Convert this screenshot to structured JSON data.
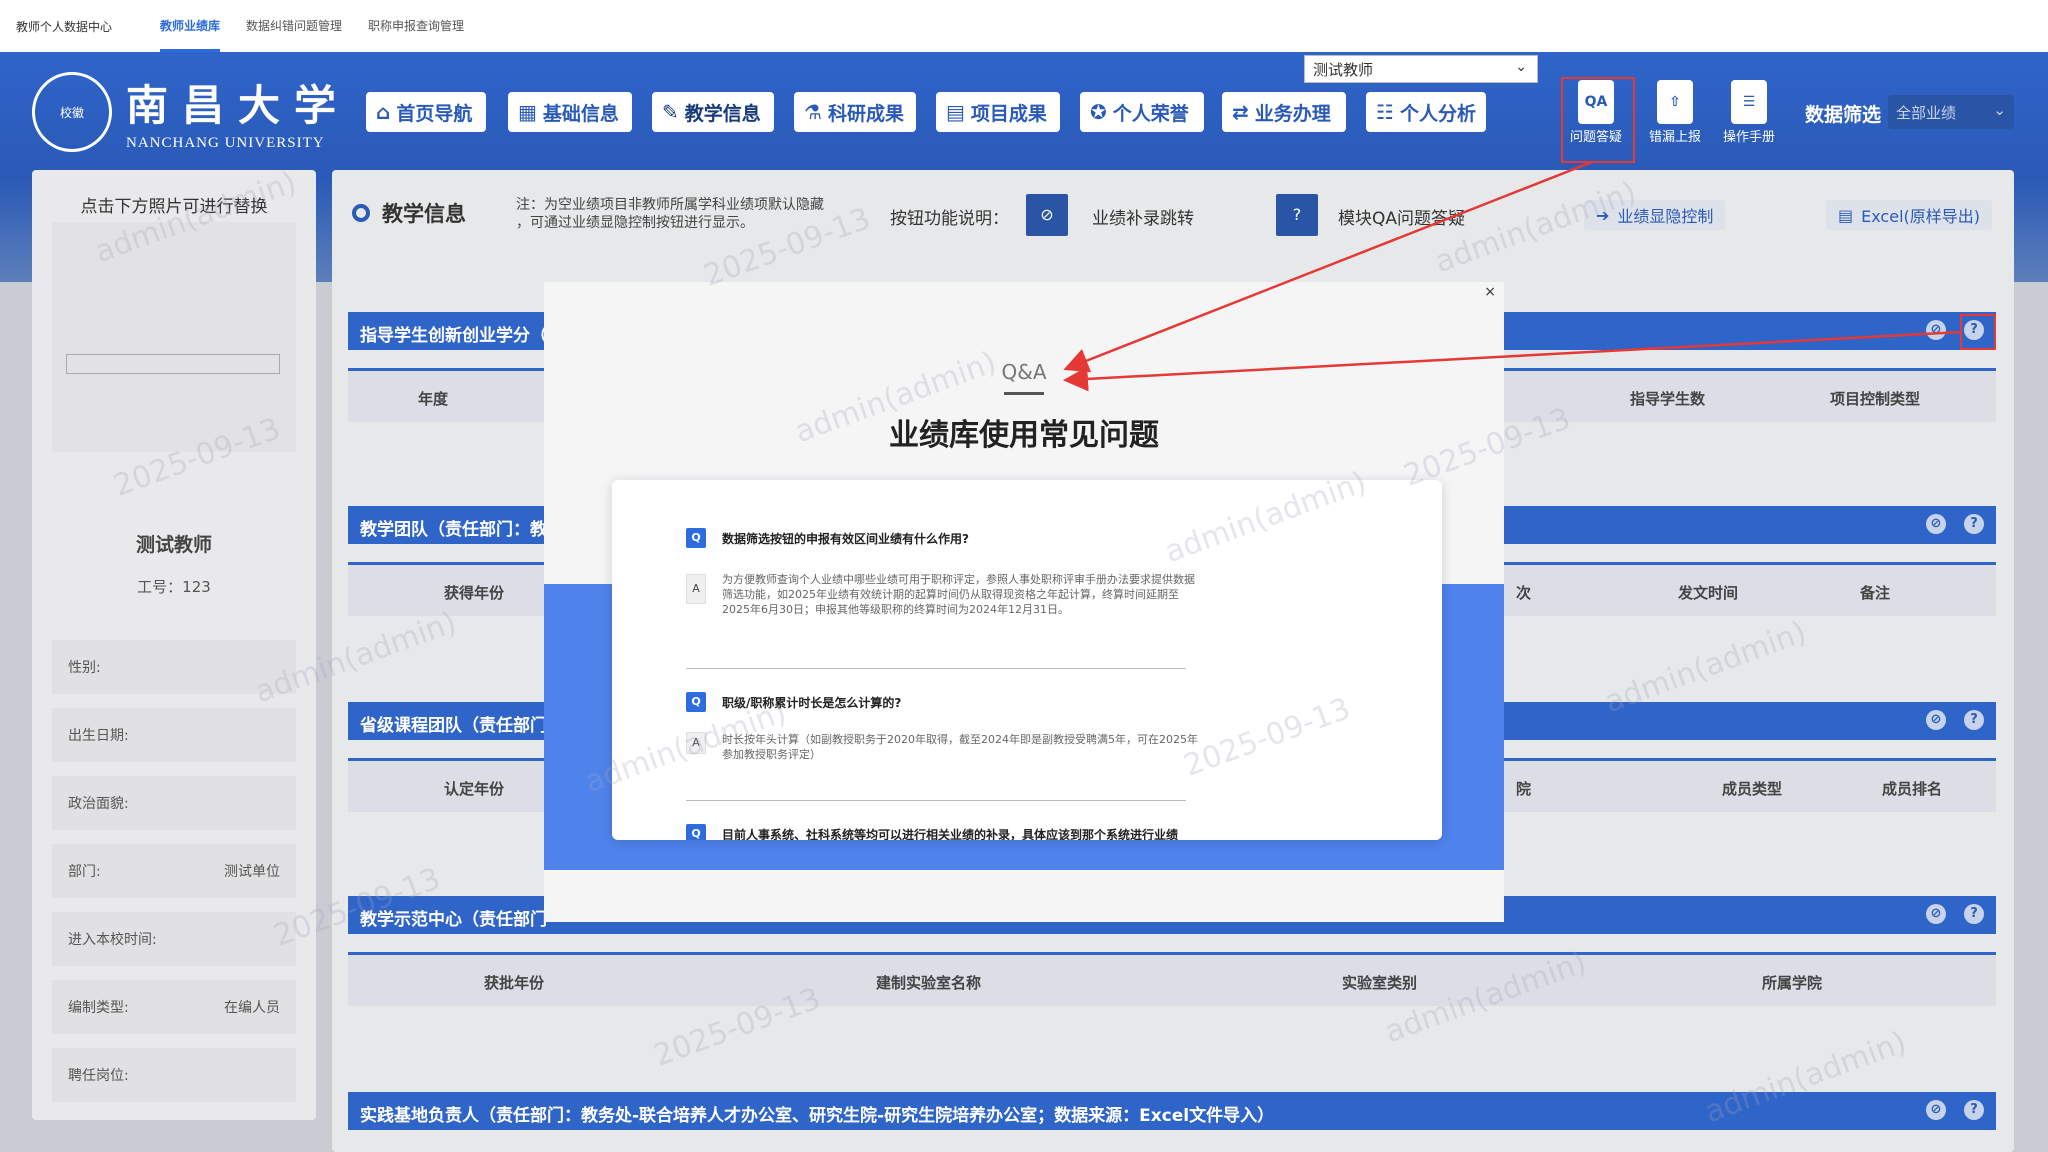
{
  "topbar": {
    "brand": "教师个人数据中心",
    "tabs": [
      "教师业绩库",
      "数据纠错问题管理",
      "职称申报查询管理"
    ]
  },
  "header": {
    "logo_cn": "南昌大学",
    "logo_en": "NANCHANG UNIVERSITY",
    "logo_seal": "校徽",
    "nav": [
      "首页导航",
      "基础信息",
      "教学信息",
      "科研成果",
      "项目成果",
      "个人荣誉",
      "业务办理",
      "个人分析"
    ],
    "role_select": "测试教师",
    "tools": [
      "问题答疑",
      "错漏上报",
      "操作手册"
    ],
    "filter_label": "数据筛选",
    "filter_value": "全部业绩"
  },
  "profile": {
    "photo_hint": "点击下方照片可进行替换",
    "name": "测试教师",
    "work_id": "工号：123",
    "fields": [
      {
        "label": "性别:",
        "value": ""
      },
      {
        "label": "出生日期:",
        "value": ""
      },
      {
        "label": "政治面貌:",
        "value": ""
      },
      {
        "label": "部门:",
        "value": "测试单位"
      },
      {
        "label": "进入本校时间:",
        "value": ""
      },
      {
        "label": "编制类型:",
        "value": "在编人员"
      },
      {
        "label": "聘任岗位:",
        "value": ""
      }
    ]
  },
  "main": {
    "title": "教学信息",
    "note_line1": "注：为空业绩项目非教师所属学科业绩项默认隐藏",
    "note_line2": "，可通过业绩显隐控制按钮进行显示。",
    "legend_label": "按钮功能说明：",
    "legend_jump": "业绩补录跳转",
    "legend_qa": "模块QA问题答疑",
    "toggle_btn": "业绩显隐控制",
    "export_btn": "Excel(原样导出)",
    "sections": [
      {
        "title": "指导学生创新创业学分（",
        "cols": [
          "年度",
          "指导学生数",
          "项目控制类型"
        ]
      },
      {
        "title": "教学团队（责任部门：教",
        "cols": [
          "获得年份",
          "次",
          "发文时间",
          "备注"
        ]
      },
      {
        "title": "省级课程团队（责任部门",
        "cols": [
          "认定年份",
          "院",
          "成员类型",
          "成员排名"
        ]
      },
      {
        "title": "教学示范中心（责任部门",
        "cols": [
          "获批年份",
          "建制实验室名称",
          "实验室类别",
          "所属学院"
        ]
      },
      {
        "title": "实践基地负责人（责任部门：教务处-联合培养人才办公室、研究生院-研究生院培养办公室；数据来源：Excel文件导入）",
        "cols": []
      }
    ]
  },
  "modal": {
    "close": "×",
    "qa_label": "Q&A",
    "title": "业绩库使用常见问题",
    "items": [
      {
        "q": "数据筛选按钮的申报有效区间业绩有什么作用?",
        "a": "为方便教师查询个人业绩中哪些业绩可用于职称评定，参照人事处职称评审手册办法要求提供数据筛选功能，如2025年业绩有效统计期的起算时间仍从取得现资格之年起计算，终算时间延期至2025年6月30日；申报其他等级职称的终算时间为2024年12月31日。"
      },
      {
        "q": "职级/职称累计时长是怎么计算的?",
        "a": "时长按年头计算（如副教授职务于2020年取得，截至2024年即是副教授受聘满5年，可在2025年参加教授职务评定）"
      },
      {
        "q": "目前人事系统、社科系统等均可以进行相关业绩的补录，具体应该到那个系统进行业绩",
        "a": ""
      }
    ],
    "q_badge": "Q",
    "a_badge": "A"
  },
  "watermark": [
    "admin(admin)",
    "2025-09-13"
  ],
  "colors": {
    "header_blue": "#2f64c9",
    "modal_band": "#4f83ec",
    "annotation_red": "#e53935"
  }
}
